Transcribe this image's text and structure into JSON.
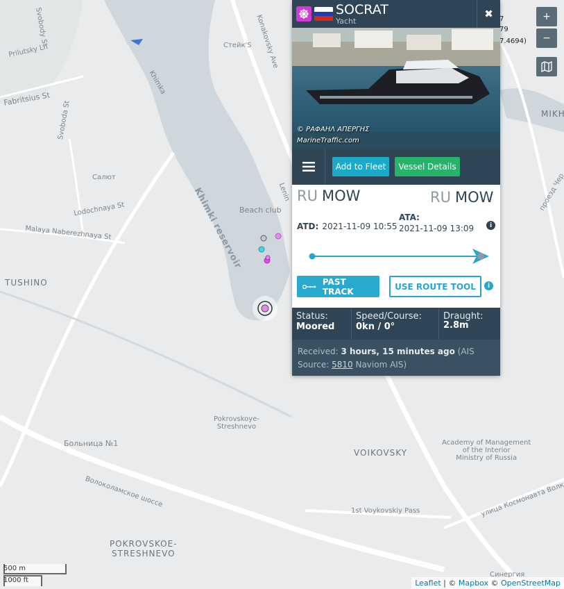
{
  "vessel": {
    "name": "SOCRAT",
    "type": "Yacht",
    "flag_country": "Russia",
    "type_color": "#d13ad8"
  },
  "photo": {
    "credit_line1": "© ΡΑΦΑΗΛ ΑΠΕΡΓΗΣ",
    "credit_line2": "MarineTraffic.com"
  },
  "toolbar": {
    "add_fleet_label": "Add to Fleet",
    "vessel_details_label": "Vessel Details"
  },
  "voyage": {
    "departure": {
      "country": "RU",
      "port": "MOW"
    },
    "arrival": {
      "country": "RU",
      "port": "MOW"
    },
    "atd_label": "ATD:",
    "atd_value": "2021-11-09 10:55",
    "ata_label": "ATA:",
    "ata_value": "2021-11-09 13:09",
    "progress": 1.0
  },
  "track_buttons": {
    "past_track": "PAST TRACK",
    "route_tool": "USE ROUTE TOOL"
  },
  "status": {
    "status_label": "Status:",
    "status_value": "Moored",
    "speed_label": "Speed/Course:",
    "speed_value": "0kn / 0°",
    "draught_label": "Draught:",
    "draught_value": "2.8m"
  },
  "received": {
    "label": "Received:",
    "time": "3 hours, 15 minutes ago",
    "source_prefix": "(AIS Source:",
    "source_id": "5810",
    "source_suffix": "Naviom AIS)"
  },
  "map_controls": {
    "zoom_in": "+",
    "zoom_out": "−"
  },
  "coord_fragments": {
    "a": "7",
    "b": "79",
    "c": "7.4694)"
  },
  "map_labels": {
    "svobody": "Svobody St",
    "priyutsky": "Prilutsky Ln",
    "fabritsius": "Fabritsius St",
    "svoboda": "Svoboda St",
    "salyut": "Салют",
    "lodochnaya": "Lodochnaya St",
    "malaya": "Malaya Naberezhnaya St",
    "tushino": "TUSHINO",
    "steik": "Стейк'S",
    "konakovsky": "Konakovsky Ave",
    "khimka": "Khimka",
    "reservoir": "Khimki reservoir",
    "beach": "Beach club",
    "lenin": "Lenin",
    "pokrovskoye": "Pokrovskoye-\nStreshnevo",
    "bolnitsa": "Больница №1",
    "volokolamskoe": "Волоколамское шоссе",
    "voikovsky_district": "VOIKOVSKY",
    "voykovsky_pass": "1st Voykovskiy Pass",
    "academy": "Academy of Management\nof the Interior\nMinistry of Russia",
    "kosmonavta": "улица Космонавта Волкова",
    "pokrovskoe_big": "POKROVSKOE-\nSTRESHNEVO",
    "sinergiya": "Синергия",
    "proezd": "проезд Чер",
    "mikh": "MIKH"
  },
  "scale": {
    "metric": "500 m",
    "imperial": "1000 ft"
  },
  "attribution": {
    "leaflet": "Leaflet",
    "sep1": " | © ",
    "mapbox": "Mapbox",
    "sep2": " © ",
    "osm": "OpenStreetMap"
  }
}
